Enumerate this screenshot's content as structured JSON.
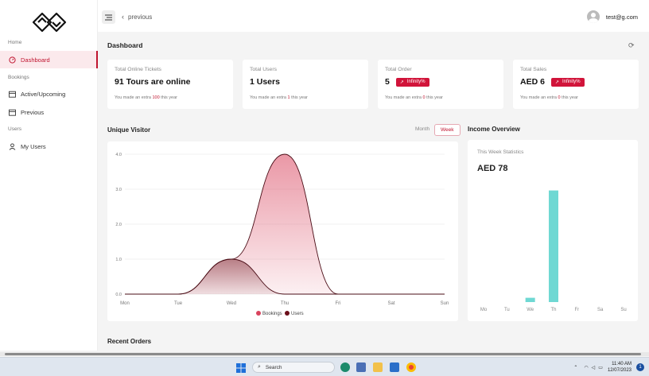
{
  "sidebar": {
    "sections": [
      "Home",
      "Bookings",
      "Users"
    ],
    "items": [
      {
        "label": "Dashboard",
        "icon": "dashboard-icon",
        "active": true
      },
      {
        "label": "Active/Upcoming",
        "icon": "calendar-icon",
        "active": false
      },
      {
        "label": "Previous",
        "icon": "calendar-icon",
        "active": false
      },
      {
        "label": "My Users",
        "icon": "user-icon",
        "active": false
      }
    ]
  },
  "topbar": {
    "back_label": "previous",
    "user_email": "test@g.com"
  },
  "dashboard": {
    "title": "Dashboard",
    "cards": [
      {
        "label": "Total Online Tickets",
        "value": "91 Tours are online",
        "badge": "",
        "sub_pre": "You made an extra",
        "sub_num": "100",
        "sub_post": "this year"
      },
      {
        "label": "Total Users",
        "value": "1 Users",
        "badge": "",
        "sub_pre": "You made an extra",
        "sub_num": "1",
        "sub_post": "this year"
      },
      {
        "label": "Total Order",
        "value": "5",
        "badge": "Infinity%",
        "sub_pre": "You made an extra",
        "sub_num": "0",
        "sub_post": "this year"
      },
      {
        "label": "Total Sales",
        "value": "AED 6",
        "badge": "Infinity%",
        "sub_pre": "You made an extra",
        "sub_num": "0",
        "sub_post": "this year"
      }
    ]
  },
  "unique_visitor": {
    "title": "Unique Visitor",
    "toggles": [
      "Month",
      "Week"
    ],
    "active_toggle": "Week"
  },
  "income": {
    "title": "Income Overview",
    "subtitle": "This Week Statistics",
    "value": "AED 78"
  },
  "recent_orders": {
    "title": "Recent Orders"
  },
  "taskbar": {
    "search_placeholder": "Search",
    "time": "11:40 AM",
    "date": "12/07/2023",
    "notifications": "1"
  },
  "colors": {
    "accent": "#c0142f",
    "bookings": "#d9435d",
    "users": "#6b0f1a",
    "income_bar": "#6fd8d3"
  },
  "chart_data": [
    {
      "type": "area",
      "categories": [
        "Mon",
        "Tue",
        "Wed",
        "Thu",
        "Fri",
        "Sat",
        "Sun"
      ],
      "ylim": [
        0,
        4
      ],
      "yticks": [
        "0.0",
        "1.0",
        "2.0",
        "3.0",
        "4.0"
      ],
      "series": [
        {
          "name": "Bookings",
          "values": [
            0,
            0,
            1,
            4,
            0,
            0,
            0
          ],
          "color": "#d9435d"
        },
        {
          "name": "Users",
          "values": [
            0,
            0,
            1,
            0,
            0,
            0,
            0
          ],
          "color": "#6b0f1a"
        }
      ],
      "legend": "bottom",
      "grid": true
    },
    {
      "type": "bar",
      "categories": [
        "Mo",
        "Tu",
        "We",
        "Th",
        "Fr",
        "Sa",
        "Su"
      ],
      "values": [
        0,
        0,
        3,
        78,
        0,
        0,
        0
      ],
      "ylim": [
        0,
        80
      ],
      "color": "#6fd8d3"
    }
  ]
}
